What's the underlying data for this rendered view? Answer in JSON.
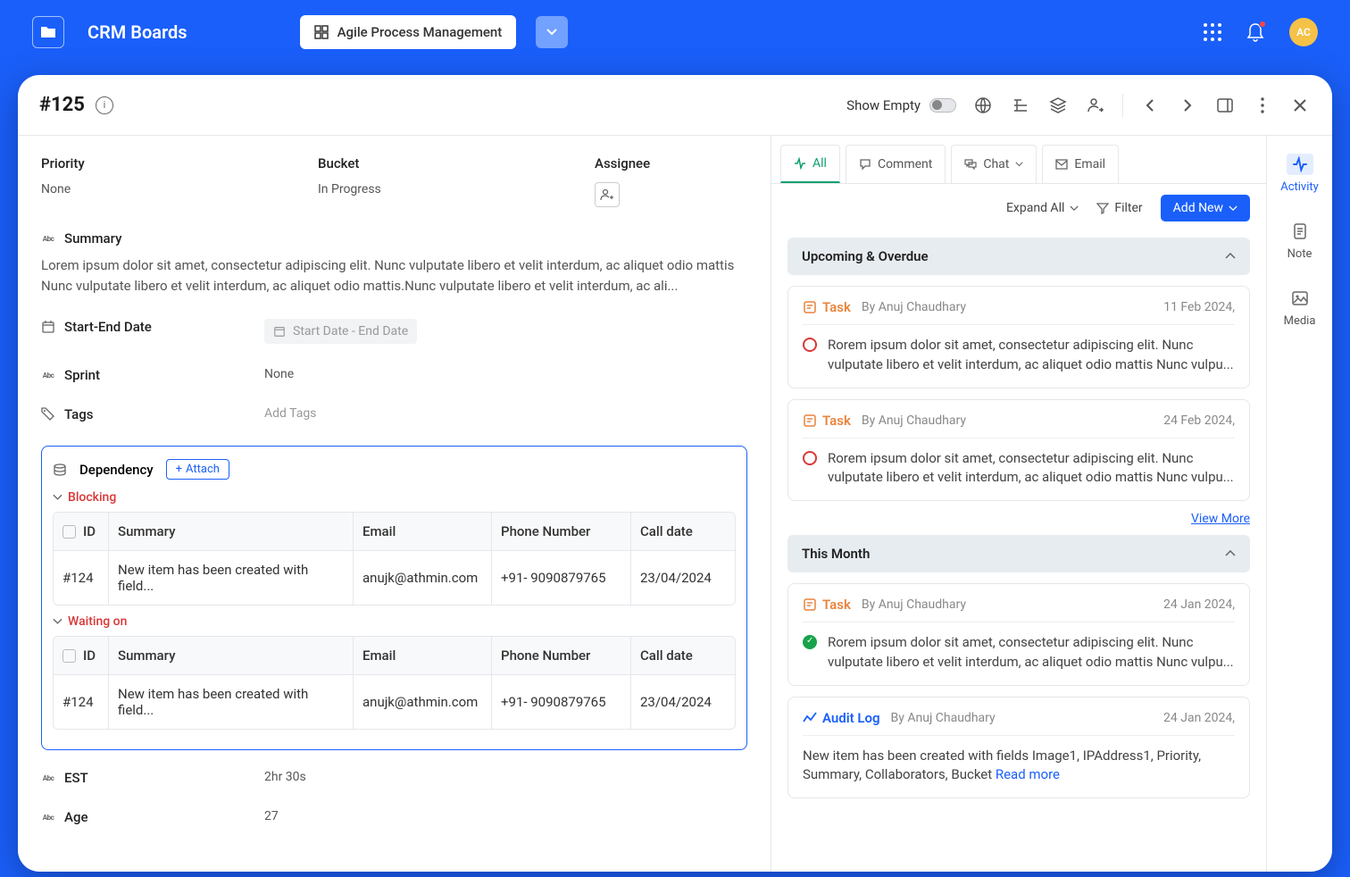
{
  "header": {
    "app_title": "CRM Boards",
    "board_name": "Agile Process Management",
    "avatar_initials": "AC"
  },
  "record": {
    "title": "#125",
    "show_empty_label": "Show Empty",
    "priority_label": "Priority",
    "priority_value": "None",
    "bucket_label": "Bucket",
    "bucket_value": "In Progress",
    "assignee_label": "Assignee",
    "summary_label": "Summary",
    "summary_text": "Lorem ipsum dolor sit amet, consectetur adipiscing elit. Nunc vulputate libero et velit interdum, ac aliquet odio mattis Nunc vulputate libero et velit interdum, ac aliquet odio mattis.Nunc vulputate libero et velit interdum, ac ali...",
    "date_label": "Start-End Date",
    "date_placeholder": "Start Date - End Date",
    "sprint_label": "Sprint",
    "sprint_value": "None",
    "tags_label": "Tags",
    "tags_placeholder": "Add Tags",
    "est_label": "EST",
    "est_value": "2hr 30s",
    "age_label": "Age",
    "age_value": "27"
  },
  "dependency": {
    "title": "Dependency",
    "attach_label": "Attach",
    "blocking_label": "Blocking",
    "waiting_label": "Waiting on",
    "columns": {
      "id": "ID",
      "summary": "Summary",
      "email": "Email",
      "phone": "Phone Number",
      "call_date": "Call date"
    },
    "blocking_row": {
      "id": "#124",
      "summary": "New item has been created with field...",
      "email": "anujk@athmin.com",
      "phone": "+91- 9090879765",
      "call_date": "23/04/2024"
    },
    "waiting_row": {
      "id": "#124",
      "summary": "New item has been created with field...",
      "email": "anujk@athmin.com",
      "phone": "+91- 9090879765",
      "call_date": "23/04/2024"
    }
  },
  "activity": {
    "tabs": {
      "all": "All",
      "comment": "Comment",
      "chat": "Chat",
      "email": "Email"
    },
    "expand_all": "Expand All",
    "filter": "Filter",
    "add_new": "Add New",
    "group_upcoming": "Upcoming & Overdue",
    "group_month": "This Month",
    "view_more": "View More",
    "read_more": "Read more",
    "task_label": "Task",
    "audit_label": "Audit Log",
    "items": {
      "t1": {
        "author": "By Anuj Chaudhary",
        "date": "11 Feb 2024,",
        "text": "Rorem ipsum dolor sit amet, consectetur adipiscing elit. Nunc vulputate libero et velit interdum, ac aliquet odio mattis Nunc vulpu..."
      },
      "t2": {
        "author": "By Anuj Chaudhary",
        "date": "24 Feb 2024,",
        "text": "Rorem ipsum dolor sit amet, consectetur adipiscing elit. Nunc vulputate libero et velit interdum, ac aliquet odio mattis Nunc vulpu..."
      },
      "t3": {
        "author": "By Anuj Chaudhary",
        "date": "24 Jan 2024,",
        "text": "Rorem ipsum dolor sit amet, consectetur adipiscing elit. Nunc vulputate libero et velit interdum, ac aliquet odio mattis Nunc vulpu..."
      },
      "a1": {
        "author": "By Anuj Chaudhary",
        "date": "24 Jan 2024,",
        "text": "New item has been created with fields Image1, IPAddress1, Priority, Summary, Collaborators, Bucket "
      }
    }
  },
  "sidebar": {
    "activity": "Activity",
    "note": "Note",
    "media": "Media"
  }
}
